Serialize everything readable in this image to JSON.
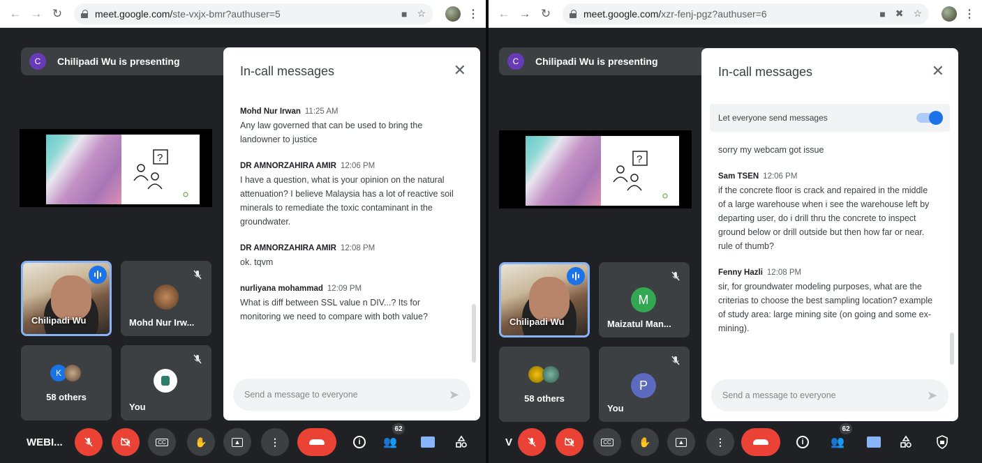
{
  "left": {
    "url_host": "meet.google.com/",
    "url_path": "ste-vxjx-bmr?authuser=5",
    "presenting": {
      "avatar_letter": "C",
      "text": "Chilipadi Wu is presenting"
    },
    "tiles": {
      "main": "Chilipadi Wu",
      "second": "Mohd Nur Irw...",
      "others": "58 others",
      "others_avatar_letter": "K",
      "you": "You"
    },
    "panel": {
      "title": "In-call messages",
      "messages": [
        {
          "sender": "Mohd Nur Irwan",
          "time": "11:25 AM",
          "text": "Any law governed that can be used to bring the landowner to justice"
        },
        {
          "sender": "DR AMNORZAHIRA AMIR",
          "time": "12:06 PM",
          "text": "I have a question, what is your opinion on the natural attenuation? I believe Malaysia has a lot of reactive soil minerals to remediate the toxic contaminant in the groundwater."
        },
        {
          "sender": "DR AMNORZAHIRA AMIR",
          "time": "12:08 PM",
          "text": "ok. tqvm"
        },
        {
          "sender": "nurliyana mohammad",
          "time": "12:09 PM",
          "text": "What is diff between SSL value n DIV...? Its for monitoring we need to compare with both value?"
        }
      ],
      "input_placeholder": "Send a message to everyone"
    },
    "controls": {
      "meeting_code": "WEBI...",
      "participants_badge": "62"
    }
  },
  "right": {
    "url_host": "meet.google.com/",
    "url_path": "xzr-fenj-pgz?authuser=6",
    "presenting": {
      "avatar_letter": "C",
      "text": "Chilipadi Wu is presenting"
    },
    "tiles": {
      "main": "Chilipadi Wu",
      "second": "Maizatul Man...",
      "second_avatar_letter": "M",
      "others": "58 others",
      "you": "You",
      "you_avatar_letter": "P"
    },
    "panel": {
      "title": "In-call messages",
      "toggle_label": "Let everyone send messages",
      "orphan_text": "sorry my webcam got issue",
      "messages": [
        {
          "sender": "Sam TSEN",
          "time": "12:06 PM",
          "text": "if the concrete floor is crack and repaired in the middle of a large warehouse when i see the warehouse left by departing user, do i drill thru the concrete to inspect ground below or drill outside but then how far or near. rule of thumb?"
        },
        {
          "sender": "Fenny Hazli",
          "time": "12:08 PM",
          "text": "sir,  for groundwater modeling purposes, what are the criterias to choose the best sampling location? example of study area: large mining site (on going and some ex-mining)."
        }
      ],
      "input_placeholder": "Send a message to everyone"
    },
    "controls": {
      "meeting_code": "V",
      "participants_badge": "62"
    }
  },
  "colors": {
    "meet_bg": "#202124",
    "tile_bg": "#3c4043",
    "accent": "#1a73e8",
    "red": "#ea4335",
    "speaking_border": "#8ab4f8"
  }
}
